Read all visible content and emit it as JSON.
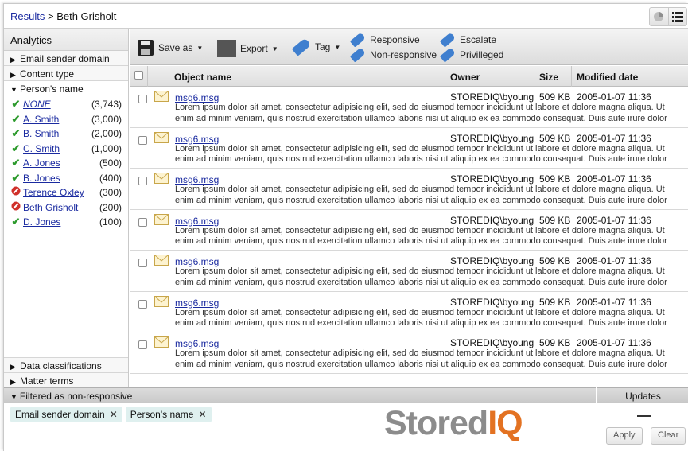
{
  "breadcrumb": {
    "link": "Results",
    "separator": ">",
    "current": "Beth Grisholt"
  },
  "analytics": {
    "title": "Analytics",
    "facets_top": [
      {
        "label": "Email sender domain",
        "state": "collapsed"
      },
      {
        "label": "Content type",
        "state": "collapsed"
      },
      {
        "label": "Person's name",
        "state": "expanded"
      }
    ],
    "persons": [
      {
        "name": "NONE",
        "count": "(3,743)",
        "status": "included",
        "italic": true
      },
      {
        "name": "A. Smith",
        "count": "(3,000)",
        "status": "included"
      },
      {
        "name": "B. Smith",
        "count": "(2,000)",
        "status": "included"
      },
      {
        "name": "C. Smith",
        "count": "(1,000)",
        "status": "included"
      },
      {
        "name": "A. Jones",
        "count": "(500)",
        "status": "included"
      },
      {
        "name": "B. Jones",
        "count": "(400)",
        "status": "included"
      },
      {
        "name": "Terence Oxley",
        "count": "(300)",
        "status": "excluded"
      },
      {
        "name": "Beth Grisholt",
        "count": "(200)",
        "status": "excluded"
      },
      {
        "name": "D. Jones",
        "count": "(100)",
        "status": "included"
      }
    ],
    "facets_bottom": [
      {
        "label": "Data classifications",
        "state": "collapsed"
      },
      {
        "label": "Matter terms",
        "state": "collapsed"
      }
    ]
  },
  "toolbar": {
    "save_as": "Save as",
    "export": "Export",
    "tag": "Tag",
    "responsive": "Responsive",
    "non_responsive": "Non-responsive",
    "escalate": "Escalate",
    "privilleged": "Privilleged"
  },
  "table": {
    "columns": [
      "Object name",
      "Owner",
      "Size",
      "Modified date"
    ],
    "rows": [
      {
        "name": "msg6.msg",
        "owner": "STOREDIQ\\byoung",
        "size": "509 KB",
        "date": "2005-01-07 11:36",
        "line1": "Lorem ipsum dolor sit amet, consectetur adipisicing elit, sed do eiusmod tempor incididunt ut labore et dolore magna aliqua. Ut",
        "line2": "enim ad minim veniam, quis nostrud exercitation ullamco laboris nisi ut aliquip ex ea commodo consequat. Duis aute irure dolor"
      },
      {
        "name": "msg6.msg",
        "owner": "STOREDIQ\\byoung",
        "size": "509 KB",
        "date": "2005-01-07 11:36",
        "line1": "Lorem ipsum dolor sit amet, consectetur adipisicing elit, sed do eiusmod tempor incididunt ut labore et dolore magna aliqua. Ut",
        "line2": "enim ad minim veniam, quis nostrud exercitation ullamco laboris nisi ut aliquip ex ea commodo consequat. Duis aute irure dolor"
      },
      {
        "name": "msg6.msg",
        "owner": "STOREDIQ\\byoung",
        "size": "509 KB",
        "date": "2005-01-07 11:36",
        "line1": "Lorem ipsum dolor sit amet, consectetur adipisicing elit, sed do eiusmod tempor incididunt ut labore et dolore magna aliqua. Ut",
        "line2": "enim ad minim veniam, quis nostrud exercitation ullamco laboris nisi ut aliquip ex ea commodo consequat. Duis aute irure dolor"
      },
      {
        "name": "msg6.msg",
        "owner": "STOREDIQ\\byoung",
        "size": "509 KB",
        "date": "2005-01-07 11:36",
        "line1": "Lorem ipsum dolor sit amet, consectetur adipisicing elit, sed do eiusmod tempor incididunt ut labore et dolore magna aliqua. Ut",
        "line2": "enim ad minim veniam, quis nostrud exercitation ullamco laboris nisi ut aliquip ex ea commodo consequat. Duis aute irure dolor"
      },
      {
        "name": "msg6.msg",
        "owner": "STOREDIQ\\byoung",
        "size": "509 KB",
        "date": "2005-01-07 11:36",
        "line1": "Lorem ipsum dolor sit amet, consectetur adipisicing elit, sed do eiusmod tempor incididunt ut labore et dolore magna aliqua. Ut",
        "line2": "enim ad minim veniam, quis nostrud exercitation ullamco laboris nisi ut aliquip ex ea commodo consequat. Duis aute irure dolor"
      },
      {
        "name": "msg6.msg",
        "owner": "STOREDIQ\\byoung",
        "size": "509 KB",
        "date": "2005-01-07 11:36",
        "line1": "Lorem ipsum dolor sit amet, consectetur adipisicing elit, sed do eiusmod tempor incididunt ut labore et dolore magna aliqua. Ut",
        "line2": "enim ad minim veniam, quis nostrud exercitation ullamco laboris nisi ut aliquip ex ea commodo consequat. Duis aute irure dolor"
      },
      {
        "name": "msg6.msg",
        "owner": "STOREDIQ\\byoung",
        "size": "509 KB",
        "date": "2005-01-07 11:36",
        "line1": "Lorem ipsum dolor sit amet, consectetur adipisicing elit, sed do eiusmod tempor incididunt ut labore et dolore magna aliqua. Ut",
        "line2": "enim ad minim veniam, quis nostrud exercitation ullamco laboris nisi ut aliquip ex ea commodo consequat. Duis aute irure dolor"
      }
    ]
  },
  "filter": {
    "title": "Filtered as non-responsive",
    "chips": [
      "Email sender domain",
      "Person's name"
    ]
  },
  "updates": {
    "title": "Updates",
    "apply": "Apply",
    "clear": "Clear"
  },
  "logo": {
    "part1": "Stored",
    "part2": "IQ"
  },
  "colors": {
    "link": "#1a2aa0",
    "include": "#2c9a2c",
    "exclude": "#d0302a",
    "brand_orange": "#e37222",
    "chip_bg": "#dff0ef"
  }
}
